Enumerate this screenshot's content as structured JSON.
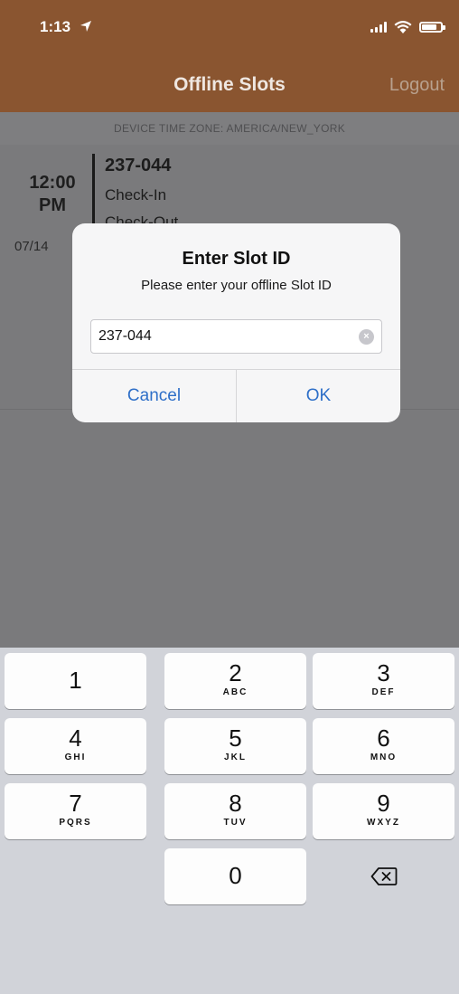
{
  "status_bar": {
    "time": "1:13"
  },
  "nav": {
    "title": "Offline Slots",
    "logout": "Logout"
  },
  "timezone": "DEVICE TIME ZONE: AMERICA/NEW_YORK",
  "slot": {
    "time": "12:00",
    "meridiem": "PM",
    "date": "07/14",
    "id": "237-044",
    "check_in": "Check-In",
    "check_out": "Check-Out"
  },
  "alert": {
    "title": "Enter Slot ID",
    "message": "Please enter your offline Slot ID",
    "input_value": "237-044",
    "cancel": "Cancel",
    "ok": "OK"
  },
  "keypad": {
    "keys": [
      {
        "digit": "1",
        "letters": ""
      },
      {
        "digit": "2",
        "letters": "ABC"
      },
      {
        "digit": "3",
        "letters": "DEF"
      },
      {
        "digit": "4",
        "letters": "GHI"
      },
      {
        "digit": "5",
        "letters": "JKL"
      },
      {
        "digit": "6",
        "letters": "MNO"
      },
      {
        "digit": "7",
        "letters": "PQRS"
      },
      {
        "digit": "8",
        "letters": "TUV"
      },
      {
        "digit": "9",
        "letters": "WXYZ"
      },
      {
        "digit": "0",
        "letters": ""
      }
    ]
  }
}
